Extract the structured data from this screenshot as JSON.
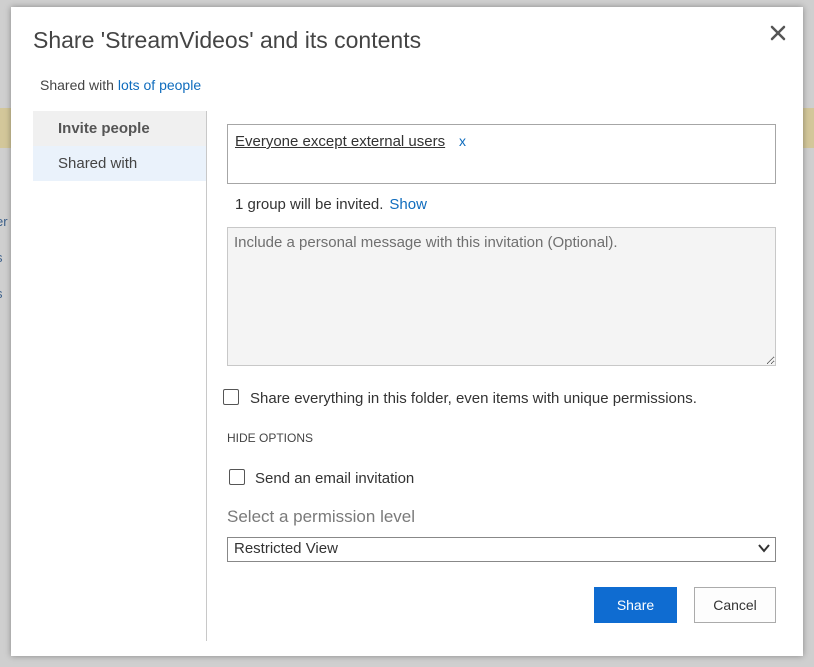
{
  "dialog": {
    "title": "Share 'StreamVideos' and its contents",
    "shared_prefix": "Shared with ",
    "shared_link": "lots of people"
  },
  "nav": {
    "items": [
      {
        "label": "Invite people"
      },
      {
        "label": "Shared with"
      }
    ]
  },
  "invite": {
    "recipient": "Everyone except external users",
    "remove_glyph": "x",
    "info": "1 group will be invited.",
    "show_link": "Show",
    "message_placeholder": "Include a personal message with this invitation (Optional).",
    "share_all_label": "Share everything in this folder, even items with unique permissions.",
    "options_toggle": "HIDE OPTIONS",
    "email_label": "Send an email invitation",
    "permission_label": "Select a permission level",
    "permission_value": "Restricted View"
  },
  "buttons": {
    "share": "Share",
    "cancel": "Cancel"
  },
  "background": {
    "fragments": [
      "er",
      "s",
      "s"
    ]
  },
  "colors": {
    "accent": "#0f6cd1",
    "link": "#0f6cbd",
    "banner": "#d3c79a"
  },
  "icons": {
    "close": "close-icon",
    "dropdown": "chevron-down-icon"
  }
}
